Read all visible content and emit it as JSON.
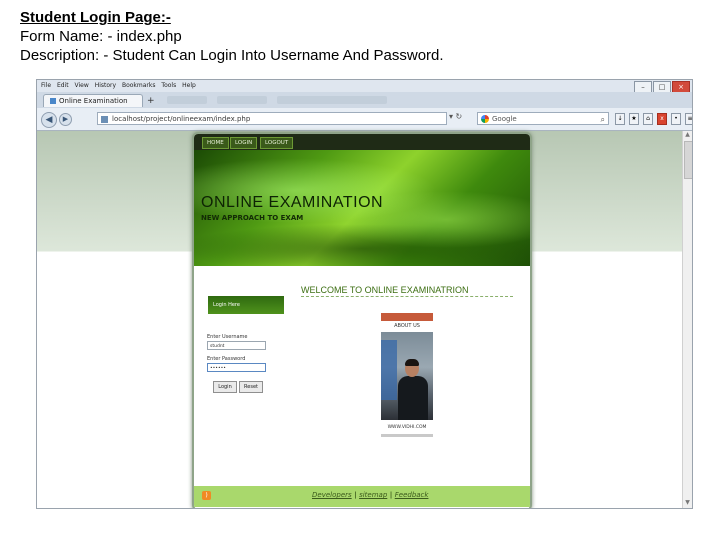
{
  "caption": {
    "title": "Student Login Page:-",
    "form_name": "Form Name: - index.php",
    "description": "Description: - Student Can Login Into Username And Password."
  },
  "browser": {
    "menu": [
      "File",
      "Edit",
      "View",
      "History",
      "Bookmarks",
      "Tools",
      "Help"
    ],
    "tab_title": "Online Examination",
    "new_tab": "+",
    "url": "localhost/project/onlineexam/index.php",
    "search_placeholder": "Google",
    "window_buttons": [
      "–",
      "□",
      "×"
    ]
  },
  "site": {
    "nav": [
      "HOME",
      "LOGIN",
      "LOGOUT"
    ],
    "banner_title": "ONLINE EXAMINATION",
    "banner_subtitle": "NEW APPROACH TO EXAM",
    "welcome": "WELCOME TO ONLINE EXAMINATRION",
    "login": {
      "header": "Login Here",
      "username_label": "Enter Username",
      "username_value": "studnt",
      "password_label": "Enter Password",
      "password_value": "••••••",
      "login_button": "Login",
      "reset_button": "Reset"
    },
    "about": {
      "label": "ABOUT US",
      "photo_caption": "WWW.VIDHI.COM"
    },
    "footer": [
      "Developers",
      "sitemap",
      "Feedback"
    ],
    "footer_sep": " | "
  }
}
